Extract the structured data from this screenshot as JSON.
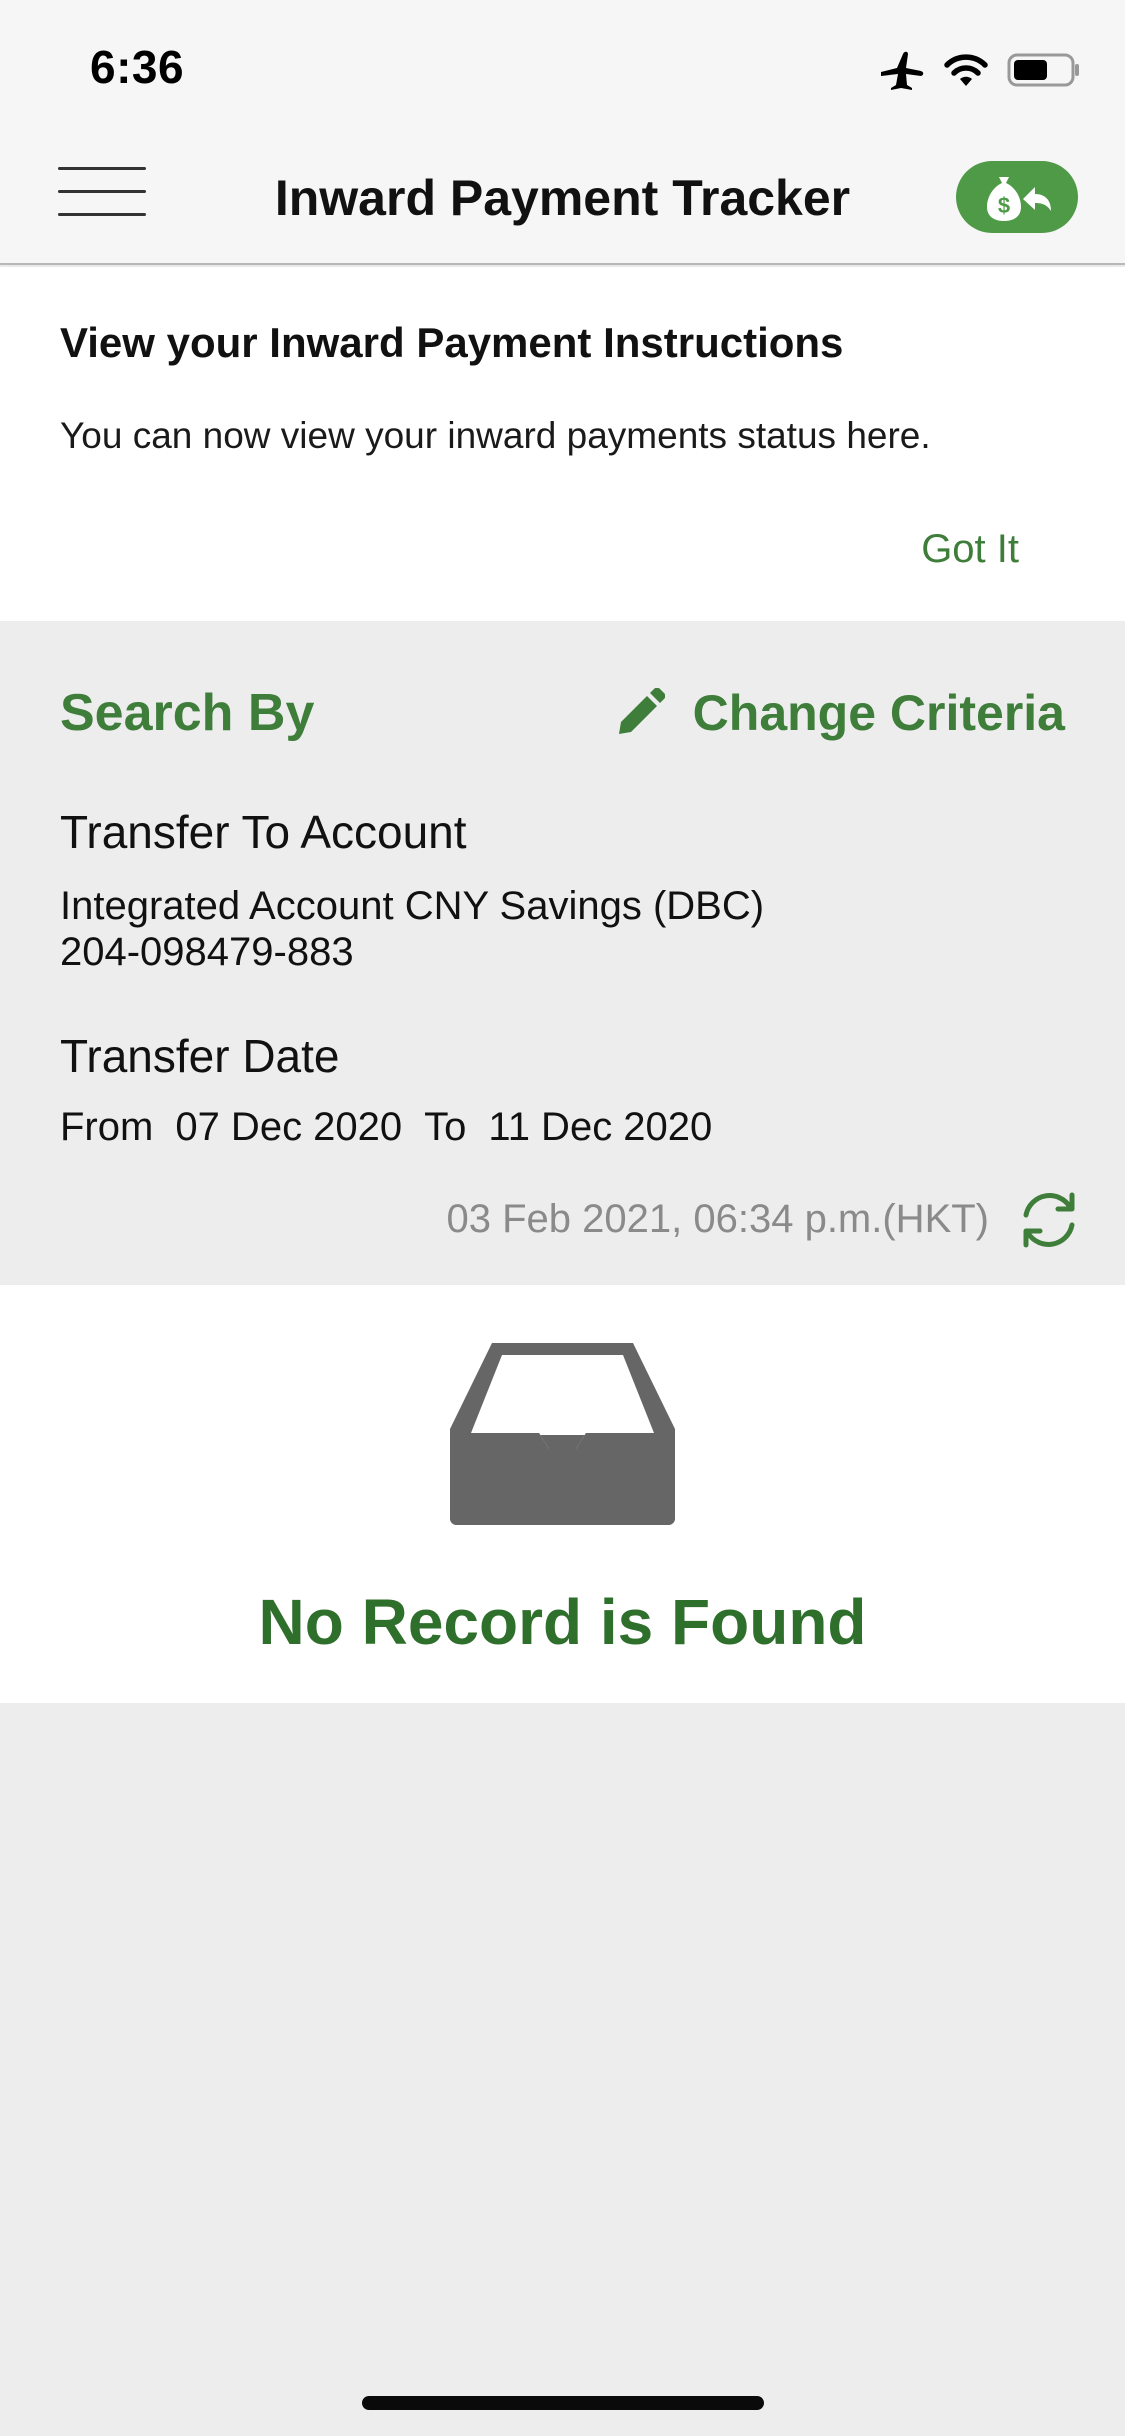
{
  "status_bar": {
    "time": "6:36",
    "icons": [
      "airplane-icon",
      "wifi-icon",
      "battery-icon"
    ]
  },
  "nav": {
    "title": "Inward Payment Tracker",
    "menu_icon": "hamburger-menu-icon",
    "action_icon": "money-bag-return-icon",
    "accent_color": "#4f9a47"
  },
  "banner": {
    "title": "View your Inward Payment Instructions",
    "body": "You can now view your inward payments status here.",
    "dismiss_label": "Got It"
  },
  "criteria": {
    "heading": "Search By",
    "change_label": "Change Criteria",
    "change_icon": "pencil-icon",
    "account_label": "Transfer To Account",
    "account_name": "Integrated Account CNY Savings (DBC)",
    "account_number": "204-098479-883",
    "date_label": "Transfer Date",
    "from_label": "From",
    "from_date": "07 Dec 2020",
    "to_label": "To",
    "to_date": "11 Dec 2020",
    "last_updated": "03 Feb 2021, 06:34 p.m.(HKT)",
    "refresh_icon": "refresh-icon",
    "brand_green": "#3f7d3a"
  },
  "empty_state": {
    "icon": "empty-inbox-icon",
    "message": "No Record is Found"
  }
}
